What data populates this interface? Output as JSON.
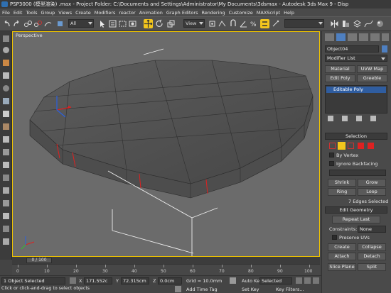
{
  "window": {
    "title": "PSP3000 (模型渲染) .max - Project Folder: C:\\Documents and Settings\\Administrator\\My Documents\\3dsmax - Autodesk 3ds Max 9 - Disp"
  },
  "menu": [
    "File",
    "Edit",
    "Tools",
    "Group",
    "Views",
    "Create",
    "Modifiers",
    "reactor",
    "Animation",
    "Graph Editors",
    "Rendering",
    "Customize",
    "MAXScript",
    "Help"
  ],
  "toolbar": {
    "selection_filter": "All",
    "reference_coord": "View",
    "named_selection": ""
  },
  "viewport": {
    "label": "Perspective"
  },
  "panel": {
    "object_name": "Object04",
    "modifier_list": "Modifier List",
    "material_btn": "Material",
    "uvw_btn": "UVW Map",
    "editpoly_btn": "Edit Poly",
    "greeble_btn": "Greeble",
    "stack_item": "Editable Poly",
    "selection_rollout": "Selection",
    "by_vertex": "By Vertex",
    "ignore_backfacing": "Ignore Backfacing",
    "shrink": "Shrink",
    "grow": "Grow",
    "ring": "Ring",
    "loop": "Loop",
    "selected_count": "7 Edges Selected",
    "edit_geometry_rollout": "Edit Geometry",
    "repeat_last": "Repeat Last",
    "constraints_label": "Constraints:",
    "constraints_value": "None",
    "preserve_uvs": "Preserve UVs",
    "create": "Create",
    "collapse": "Collapse",
    "attach": "Attach",
    "detach": "Detach",
    "slice_plane": "Slice Plane",
    "split": "Split"
  },
  "timeline": {
    "frame": "0 / 100",
    "ticks": [
      "0",
      "10",
      "20",
      "30",
      "40",
      "50",
      "60",
      "70",
      "80",
      "90",
      "100"
    ]
  },
  "status": {
    "selection": "1 Object Selected",
    "prompt": "Click or click-and-drag to select objects",
    "x_label": "X",
    "x_value": "171.552c",
    "y_label": "Y",
    "y_value": "72.315cm",
    "z_label": "Z",
    "z_value": "0.0cm",
    "grid": "Grid = 10.0mm",
    "add_time_tag": "Add Time Tag",
    "auto_key": "Auto Key",
    "auto_key_mode": "Selected",
    "set_key": "Set Key",
    "key_filters": "Key Filters..."
  },
  "colors": {
    "accent": "#f2c51d",
    "selection_blue": "#2f5da0",
    "selected_edges": "#e02020"
  }
}
